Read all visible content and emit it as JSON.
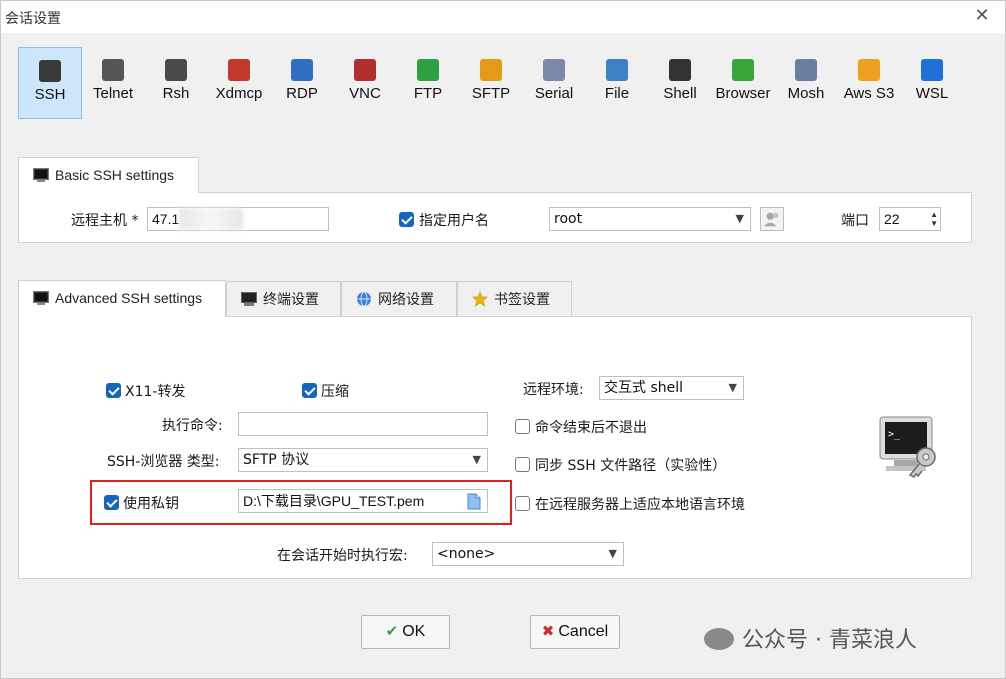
{
  "window": {
    "title": "会话设置",
    "close_glyph": "✕"
  },
  "protocols": [
    {
      "label": "SSH",
      "icon": "ssh-terminal-icon",
      "color": "#3a3a3a",
      "active": true
    },
    {
      "label": "Telnet",
      "icon": "telnet-icon",
      "color": "#555555"
    },
    {
      "label": "Rsh",
      "icon": "rsh-icon",
      "color": "#4a4a4a"
    },
    {
      "label": "Xdmcp",
      "icon": "xdmcp-icon",
      "color": "#c0392b"
    },
    {
      "label": "RDP",
      "icon": "rdp-icon",
      "color": "#2e6fc4"
    },
    {
      "label": "VNC",
      "icon": "vnc-icon",
      "color": "#b03030"
    },
    {
      "label": "FTP",
      "icon": "ftp-globe-icon",
      "color": "#2ea043"
    },
    {
      "label": "SFTP",
      "icon": "sftp-icon",
      "color": "#e39a1a"
    },
    {
      "label": "Serial",
      "icon": "serial-icon",
      "color": "#7a8aa8"
    },
    {
      "label": "File",
      "icon": "file-icon",
      "color": "#3b82c4"
    },
    {
      "label": "Shell",
      "icon": "shell-icon",
      "color": "#333333"
    },
    {
      "label": "Browser",
      "icon": "browser-icon",
      "color": "#3aa53a"
    },
    {
      "label": "Mosh",
      "icon": "mosh-icon",
      "color": "#6a7fa0"
    },
    {
      "label": "Aws S3",
      "icon": "aws-s3-icon",
      "color": "#f0a020"
    },
    {
      "label": "WSL",
      "icon": "wsl-windows-icon",
      "color": "#1f6fd6"
    }
  ],
  "basic": {
    "tab_label": "Basic SSH settings",
    "remote_host_label": "远程主机 *",
    "remote_host_value": "47.1",
    "specify_user_label": "指定用户名",
    "specify_user_checked": true,
    "username_value": "root",
    "port_label": "端口",
    "port_value": "22"
  },
  "advanced_tabs": [
    {
      "label": "Advanced SSH settings",
      "icon": "terminal-icon"
    },
    {
      "label": "终端设置",
      "icon": "monitor-icon"
    },
    {
      "label": "网络设置",
      "icon": "network-globe-icon"
    },
    {
      "label": "书签设置",
      "icon": "star-icon"
    }
  ],
  "advanced": {
    "x11_label": "X11-转发",
    "x11_checked": true,
    "compress_label": "压缩",
    "compress_checked": true,
    "remote_env_label": "远程环境:",
    "remote_env_value": "交互式 shell",
    "exec_cmd_label": "执行命令:",
    "exec_cmd_value": "",
    "no_exit_label": "命令结束后不退出",
    "no_exit_checked": false,
    "browser_type_label": "SSH-浏览器 类型:",
    "browser_type_value": "SFTP 协议",
    "sync_path_label": "同步 SSH 文件路径（实验性）",
    "sync_path_checked": false,
    "private_key_label": "使用私钥",
    "private_key_checked": true,
    "private_key_value": "D:\\下载目录\\GPU_TEST.pem",
    "locale_label": "在远程服务器上适应本地语言环境",
    "locale_checked": false,
    "macro_label": "在会话开始时执行宏:",
    "macro_value": "<none>"
  },
  "buttons": {
    "ok": "OK",
    "cancel": "Cancel"
  },
  "watermark": "公众号 · 青菜浪人",
  "colors": {
    "accent": "#1565c0",
    "highlight": "#e02020",
    "selected_tab_bg": "#cde6fb"
  }
}
